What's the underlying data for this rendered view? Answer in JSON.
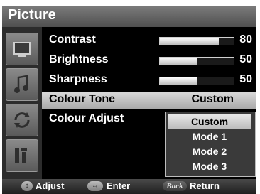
{
  "title": "Picture",
  "sidebar": {
    "icons": [
      "picture-icon",
      "sound-icon",
      "setup-icon",
      "tools-icon"
    ]
  },
  "settings": [
    {
      "label": "Contrast",
      "value": "80",
      "level": 0.8
    },
    {
      "label": "Brightness",
      "value": "50",
      "level": 0.5
    },
    {
      "label": "Sharpness",
      "value": "50",
      "level": 0.5
    }
  ],
  "colour_tone": {
    "label": "Colour Tone",
    "value": "Custom"
  },
  "colour_adjust": {
    "label": "Colour Adjust"
  },
  "dropdown": {
    "options": [
      "Custom",
      "Mode 1",
      "Mode 2",
      "Mode 3"
    ],
    "selected": "Custom"
  },
  "footer": {
    "adjust_label": "Adjust",
    "enter_label": "Enter",
    "back_key": "Back",
    "return_label": "Return"
  }
}
